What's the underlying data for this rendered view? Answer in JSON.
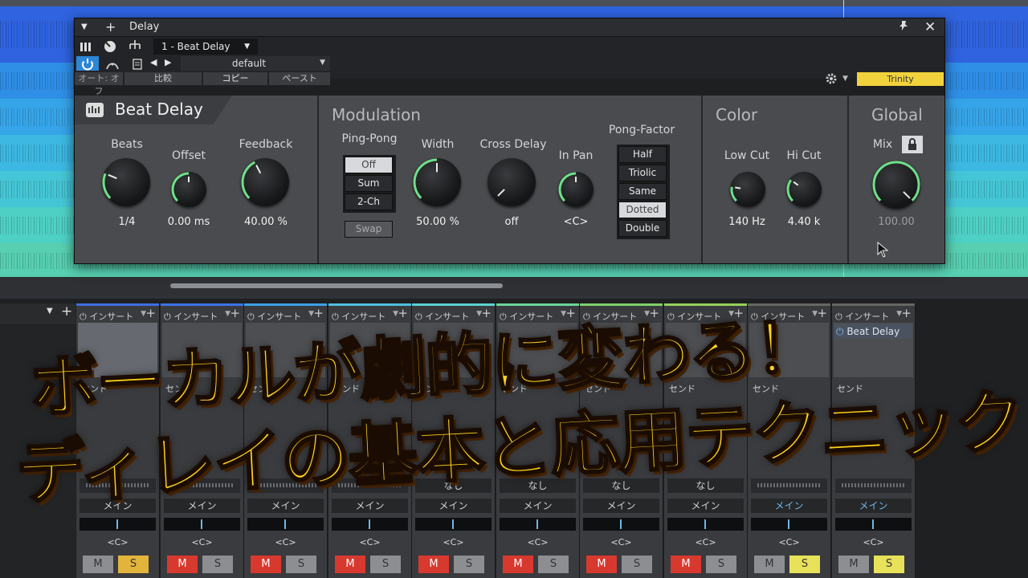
{
  "plugin": {
    "window_title": "Delay",
    "preset_slot": "1 - Beat Delay",
    "preset_name": "default",
    "auto_label": "オート: オフ",
    "compare_label": "比較",
    "copy_label": "コピー",
    "paste_label": "ペースト",
    "device_badge": "Trinity",
    "brand_title": "Beat Delay",
    "sections": {
      "main": {
        "knobs": [
          {
            "label": "Beats",
            "value": "1/4",
            "level": 0.25
          },
          {
            "label": "Offset",
            "value": "0.00 ms",
            "level": 0.5
          },
          {
            "label": "Feedback",
            "value": "40.00 %",
            "level": 0.4
          }
        ]
      },
      "modulation": {
        "title": "Modulation",
        "ping_pong_label": "Ping-Pong",
        "ping_pong_options": [
          "Off",
          "Sum",
          "2-Ch"
        ],
        "ping_pong_selected": "Off",
        "swap_label": "Swap",
        "width": {
          "label": "Width",
          "value": "50.00 %",
          "level": 0.5
        },
        "cross_delay": {
          "label": "Cross Delay",
          "value": "off",
          "level": 0.0
        },
        "in_pan": {
          "label": "In Pan",
          "value": "<C>",
          "level": 0.5
        },
        "pong_factor_label": "Pong-Factor",
        "pong_factor_options": [
          "Half",
          "Triolic",
          "Same",
          "Dotted",
          "Double"
        ],
        "pong_factor_selected": "Dotted"
      },
      "color": {
        "title": "Color",
        "low_cut": {
          "label": "Low Cut",
          "value": "140 Hz",
          "level": 0.2
        },
        "hi_cut": {
          "label": "Hi Cut",
          "value": "4.40 k",
          "level": 0.3
        }
      },
      "global": {
        "title": "Global",
        "mix": {
          "label": "Mix",
          "value": "100.00",
          "level": 1.0
        }
      }
    }
  },
  "mixer": {
    "insert_label": "インサート",
    "send_label": "センド",
    "last_insert_plugin": "Beat Delay",
    "main_label": "メイン",
    "none_label": "なし",
    "pan_label": "<C>",
    "mute_label": "M",
    "solo_label": "S",
    "strips": [
      {
        "color": "#3c6fe0",
        "mute_on": false,
        "solo_on": true
      },
      {
        "color": "#3b73e8",
        "mute_on": true,
        "solo_on": false
      },
      {
        "color": "#3ea0e6",
        "mute_on": true,
        "solo_on": false
      },
      {
        "color": "#4fbfe0",
        "mute_on": true,
        "solo_on": false
      },
      {
        "color": "#5cd2d0",
        "mute_on": true,
        "solo_on": false
      },
      {
        "color": "#6bd49a",
        "mute_on": true,
        "solo_on": false
      },
      {
        "color": "#7fd06a",
        "mute_on": true,
        "solo_on": false
      },
      {
        "color": "#95d25a",
        "mute_on": true,
        "solo_on": false
      },
      {
        "color": "#666666",
        "mute_on": false,
        "solo_on": true
      },
      {
        "color": "#666666",
        "mute_on": false,
        "solo_on": true
      }
    ]
  },
  "overlay": {
    "line1": "ボーカルが劇的に変わる！",
    "line2": "ディレイの基本と応用テクニック"
  },
  "colors": {
    "accent_green": "#6fe08a",
    "overlay_text": "#ffd21a",
    "badge_yellow": "#f2d23c"
  }
}
